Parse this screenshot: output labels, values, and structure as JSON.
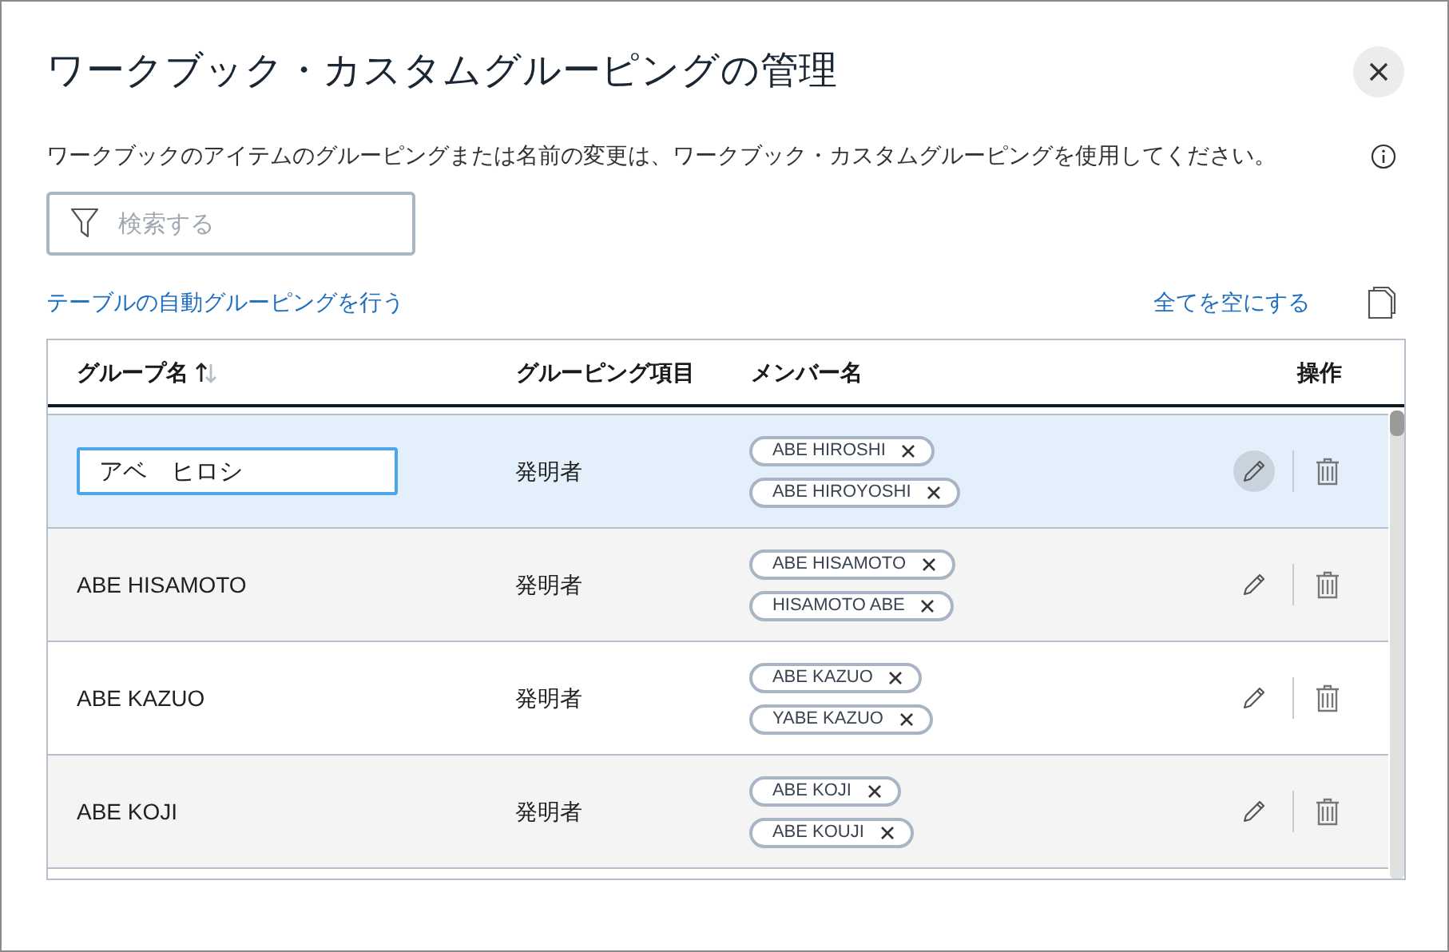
{
  "dialog": {
    "title": "ワークブック・カスタムグルーピングの管理",
    "description": "ワークブックのアイテムのグルーピングまたは名前の変更は、ワークブック・カスタムグルーピングを使用してください。"
  },
  "search": {
    "placeholder": "検索する"
  },
  "actions": {
    "auto_group": "テーブルの自動グルーピングを行う",
    "clear_all": "全てを空にする"
  },
  "table": {
    "columns": [
      "グループ名",
      "グルーピング項目",
      "メンバー名",
      "操作"
    ],
    "rows": [
      {
        "editing": true,
        "group": "アベ　ヒロシ",
        "field": "発明者",
        "members": [
          "ABE HIROSHI",
          "ABE HIROYOSHI"
        ]
      },
      {
        "editing": false,
        "group": "ABE HISAMOTO",
        "field": "発明者",
        "members": [
          "ABE HISAMOTO",
          "HISAMOTO ABE"
        ]
      },
      {
        "editing": false,
        "group": "ABE KAZUO",
        "field": "発明者",
        "members": [
          "ABE KAZUO",
          "YABE KAZUO"
        ]
      },
      {
        "editing": false,
        "group": "ABE KOJI",
        "field": "発明者",
        "members": [
          "ABE KOJI",
          "ABE KOUJI"
        ]
      }
    ]
  }
}
